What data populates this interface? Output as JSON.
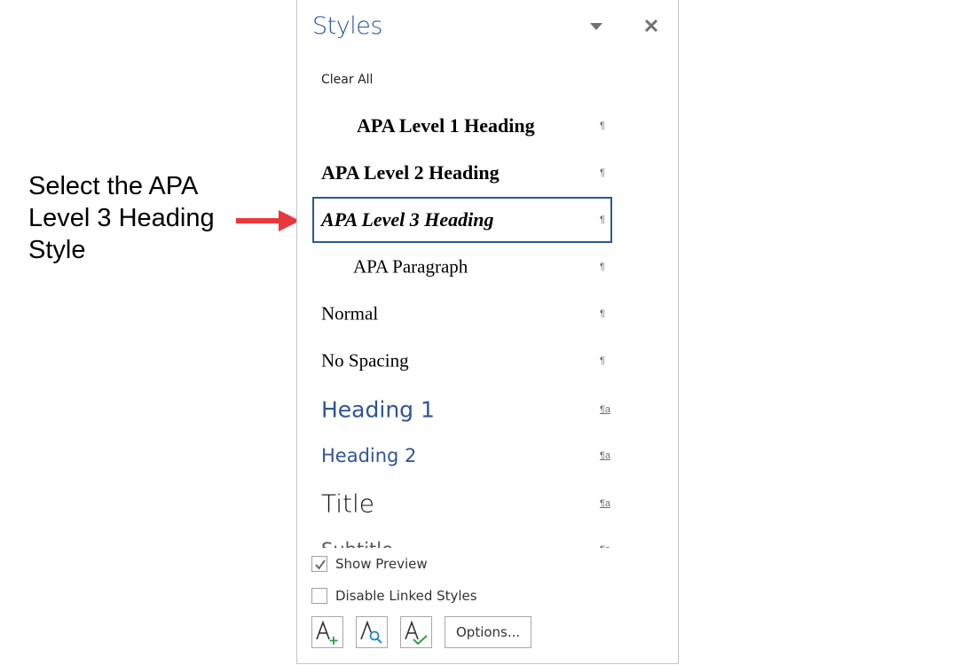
{
  "annotation": {
    "lines": [
      "Select the APA",
      "Level 3 Heading",
      "Style"
    ],
    "arrow_color": "#e8383d"
  },
  "pane": {
    "title": "Styles",
    "menu_icon": "dropdown-triangle-icon",
    "close_icon": "close-x-icon",
    "accent_color": "#2b579a",
    "clear_all_label": "Clear All",
    "styles": [
      {
        "name": "APA Level 1 Heading",
        "mark": "¶",
        "type": "paragraph"
      },
      {
        "name": "APA Level 2 Heading",
        "mark": "¶",
        "type": "paragraph"
      },
      {
        "name": "APA Level 3 Heading",
        "mark": "¶",
        "type": "paragraph",
        "selected": true
      },
      {
        "name": "APA Paragraph",
        "mark": "¶",
        "type": "paragraph"
      },
      {
        "name": "Normal",
        "mark": "¶",
        "type": "paragraph"
      },
      {
        "name": "No Spacing",
        "mark": "¶",
        "type": "paragraph"
      },
      {
        "name": "Heading 1",
        "mark": "¶a",
        "type": "linked"
      },
      {
        "name": "Heading 2",
        "mark": "¶a",
        "type": "linked"
      },
      {
        "name": "Title",
        "mark": "¶a",
        "type": "linked"
      },
      {
        "name": "Subtitle",
        "mark": "¶a",
        "type": "linked"
      }
    ],
    "show_preview": {
      "label": "Show Preview",
      "checked": true
    },
    "disable_linked": {
      "label": "Disable Linked Styles",
      "checked": false
    },
    "buttons": {
      "new_style": "new-style-icon",
      "style_inspector": "style-inspector-icon",
      "manage_styles": "manage-styles-icon",
      "options_label": "Options..."
    }
  }
}
